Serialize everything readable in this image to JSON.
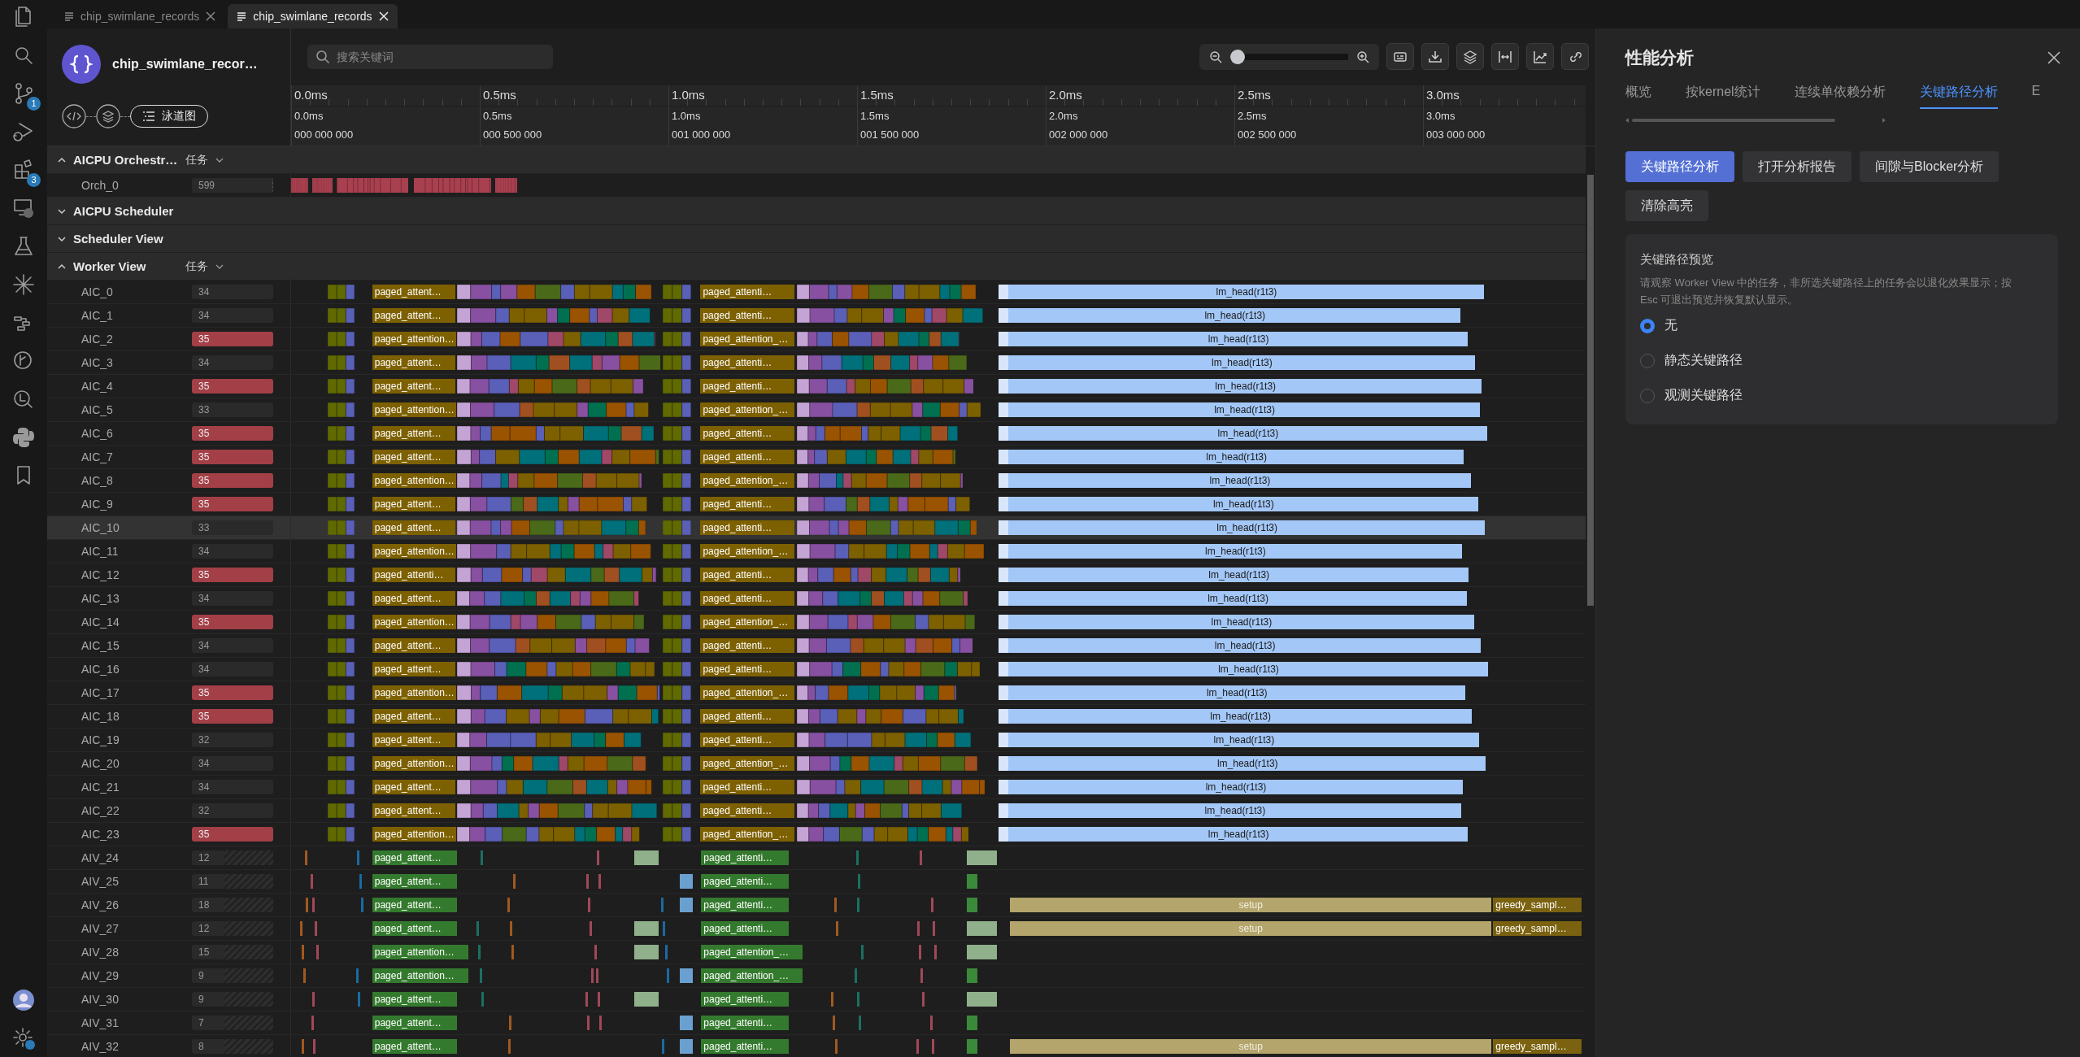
{
  "tabs": [
    {
      "label": "chip_swimlane_records",
      "selected": false
    },
    {
      "label": "chip_swimlane_records",
      "selected": true
    }
  ],
  "activity_bar": {
    "source_control_badge": "1",
    "extensions_badge": "3"
  },
  "file": {
    "title": "chip_swimlane_recor…",
    "view_button": "泳道图"
  },
  "search": {
    "placeholder": "搜索关键词"
  },
  "zoom": {
    "level": 0
  },
  "ruler": [
    {
      "major": "0.0ms",
      "minor": "0.0ms",
      "ns": "000 000 000"
    },
    {
      "major": "0.5ms",
      "minor": "0.5ms",
      "ns": "000 500 000"
    },
    {
      "major": "1.0ms",
      "minor": "1.0ms",
      "ns": "001 000 000"
    },
    {
      "major": "1.5ms",
      "minor": "1.5ms",
      "ns": "001 500 000"
    },
    {
      "major": "2.0ms",
      "minor": "2.0ms",
      "ns": "002 000 000"
    },
    {
      "major": "2.5ms",
      "minor": "2.5ms",
      "ns": "002 500 000"
    },
    {
      "major": "3.0ms",
      "minor": "3.0ms",
      "ns": "003 000 000"
    }
  ],
  "groups": [
    {
      "title": "AICPU Orchestr…",
      "expanded": true,
      "filter": "任务",
      "rows": [
        {
          "name": "Orch_0",
          "count": "599",
          "kind": "orch",
          "hot": false,
          "highlighted": false,
          "tasks": []
        }
      ]
    },
    {
      "title": "AICPU Scheduler",
      "expanded": false
    },
    {
      "title": "Scheduler View",
      "expanded": false
    },
    {
      "title": "Worker View",
      "expanded": true,
      "filter": "任务",
      "rows": [
        {
          "name": "AIC_0",
          "count": "34",
          "kind": "aic",
          "hot": false,
          "highlighted": false,
          "tasks": [
            {
              "label": "paged_attent…",
              "kind": "attn1"
            },
            {
              "label": "paged_attenti…",
              "kind": "attn2"
            },
            {
              "label": "lm_head(r1t3)",
              "kind": "lm_head"
            }
          ]
        },
        {
          "name": "AIC_1",
          "count": "34",
          "kind": "aic",
          "hot": false,
          "highlighted": false,
          "tasks": [
            {
              "label": "paged_attent…",
              "kind": "attn1"
            },
            {
              "label": "paged_attenti…",
              "kind": "attn2"
            },
            {
              "label": "lm_head(r1t3)",
              "kind": "lm_head"
            }
          ]
        },
        {
          "name": "AIC_2",
          "count": "35",
          "kind": "aic",
          "hot": true,
          "highlighted": false,
          "tasks": [
            {
              "label": "paged_attention…",
              "kind": "attn1"
            },
            {
              "label": "paged_attention_…",
              "kind": "attn2"
            },
            {
              "label": "lm_head(r1t3)",
              "kind": "lm_head"
            }
          ]
        },
        {
          "name": "AIC_3",
          "count": "34",
          "kind": "aic",
          "hot": false,
          "highlighted": false,
          "tasks": [
            {
              "label": "paged_attent…",
              "kind": "attn1"
            },
            {
              "label": "paged_attenti…",
              "kind": "attn2"
            },
            {
              "label": "lm_head(r1t3)",
              "kind": "lm_head"
            }
          ]
        },
        {
          "name": "AIC_4",
          "count": "35",
          "kind": "aic",
          "hot": true,
          "highlighted": false,
          "tasks": [
            {
              "label": "paged_attent…",
              "kind": "attn1"
            },
            {
              "label": "paged_attenti…",
              "kind": "attn2"
            },
            {
              "label": "lm_head(r1t3)",
              "kind": "lm_head"
            }
          ]
        },
        {
          "name": "AIC_5",
          "count": "33",
          "kind": "aic",
          "hot": false,
          "highlighted": false,
          "tasks": [
            {
              "label": "paged_attention…",
              "kind": "attn1"
            },
            {
              "label": "paged_attention_…",
              "kind": "attn2"
            },
            {
              "label": "lm_head(r1t3)",
              "kind": "lm_head"
            }
          ]
        },
        {
          "name": "AIC_6",
          "count": "35",
          "kind": "aic",
          "hot": true,
          "highlighted": false,
          "tasks": [
            {
              "label": "paged_attent…",
              "kind": "attn1"
            },
            {
              "label": "paged_attenti…",
              "kind": "attn2"
            },
            {
              "label": "lm_head(r1t3)",
              "kind": "lm_head"
            }
          ]
        },
        {
          "name": "AIC_7",
          "count": "35",
          "kind": "aic",
          "hot": true,
          "highlighted": false,
          "tasks": [
            {
              "label": "paged_attent…",
              "kind": "attn1"
            },
            {
              "label": "paged_attenti…",
              "kind": "attn2"
            },
            {
              "label": "lm_head(r1t3)",
              "kind": "lm_head"
            }
          ]
        },
        {
          "name": "AIC_8",
          "count": "35",
          "kind": "aic",
          "hot": true,
          "highlighted": false,
          "tasks": [
            {
              "label": "paged_attention…",
              "kind": "attn1"
            },
            {
              "label": "paged_attention_…",
              "kind": "attn2"
            },
            {
              "label": "lm_head(r1t3)",
              "kind": "lm_head"
            }
          ]
        },
        {
          "name": "AIC_9",
          "count": "35",
          "kind": "aic",
          "hot": true,
          "highlighted": false,
          "tasks": [
            {
              "label": "paged_attent…",
              "kind": "attn1"
            },
            {
              "label": "paged_attenti…",
              "kind": "attn2"
            },
            {
              "label": "lm_head(r1t3)",
              "kind": "lm_head"
            }
          ]
        },
        {
          "name": "AIC_10",
          "count": "33",
          "kind": "aic",
          "hot": false,
          "highlighted": true,
          "tasks": [
            {
              "label": "paged_attent…",
              "kind": "attn1"
            },
            {
              "label": "paged_attenti…",
              "kind": "attn2"
            },
            {
              "label": "lm_head(r1t3)",
              "kind": "lm_head"
            }
          ]
        },
        {
          "name": "AIC_11",
          "count": "34",
          "kind": "aic",
          "hot": false,
          "highlighted": false,
          "tasks": [
            {
              "label": "paged_attention…",
              "kind": "attn1"
            },
            {
              "label": "paged_attention_…",
              "kind": "attn2"
            },
            {
              "label": "lm_head(r1t3)",
              "kind": "lm_head"
            }
          ]
        },
        {
          "name": "AIC_12",
          "count": "35",
          "kind": "aic",
          "hot": true,
          "highlighted": false,
          "tasks": [
            {
              "label": "paged_attenti…",
              "kind": "attn1"
            },
            {
              "label": "paged_attenti…",
              "kind": "attn2"
            },
            {
              "label": "lm_head(r1t3)",
              "kind": "lm_head"
            }
          ]
        },
        {
          "name": "AIC_13",
          "count": "34",
          "kind": "aic",
          "hot": false,
          "highlighted": false,
          "tasks": [
            {
              "label": "paged_attent…",
              "kind": "attn1"
            },
            {
              "label": "paged_attenti…",
              "kind": "attn2"
            },
            {
              "label": "lm_head(r1t3)",
              "kind": "lm_head"
            }
          ]
        },
        {
          "name": "AIC_14",
          "count": "35",
          "kind": "aic",
          "hot": true,
          "highlighted": false,
          "tasks": [
            {
              "label": "paged_attention…",
              "kind": "attn1"
            },
            {
              "label": "paged_attention_…",
              "kind": "attn2"
            },
            {
              "label": "lm_head(r1t3)",
              "kind": "lm_head"
            }
          ]
        },
        {
          "name": "AIC_15",
          "count": "34",
          "kind": "aic",
          "hot": false,
          "highlighted": false,
          "tasks": [
            {
              "label": "paged_attent…",
              "kind": "attn1"
            },
            {
              "label": "paged_attenti…",
              "kind": "attn2"
            },
            {
              "label": "lm_head(r1t3)",
              "kind": "lm_head"
            }
          ]
        },
        {
          "name": "AIC_16",
          "count": "34",
          "kind": "aic",
          "hot": false,
          "highlighted": false,
          "tasks": [
            {
              "label": "paged_attent…",
              "kind": "attn1"
            },
            {
              "label": "paged_attenti…",
              "kind": "attn2"
            },
            {
              "label": "lm_head(r1t3)",
              "kind": "lm_head"
            }
          ]
        },
        {
          "name": "AIC_17",
          "count": "35",
          "kind": "aic",
          "hot": true,
          "highlighted": false,
          "tasks": [
            {
              "label": "paged_attention…",
              "kind": "attn1"
            },
            {
              "label": "paged_attention_…",
              "kind": "attn2"
            },
            {
              "label": "lm_head(r1t3)",
              "kind": "lm_head"
            }
          ]
        },
        {
          "name": "AIC_18",
          "count": "35",
          "kind": "aic",
          "hot": true,
          "highlighted": false,
          "tasks": [
            {
              "label": "paged_attent…",
              "kind": "attn1"
            },
            {
              "label": "paged_attenti…",
              "kind": "attn2"
            },
            {
              "label": "lm_head(r1t3)",
              "kind": "lm_head"
            }
          ]
        },
        {
          "name": "AIC_19",
          "count": "32",
          "kind": "aic",
          "hot": false,
          "highlighted": false,
          "tasks": [
            {
              "label": "paged_attent…",
              "kind": "attn1"
            },
            {
              "label": "paged_attenti…",
              "kind": "attn2"
            },
            {
              "label": "lm_head(r1t3)",
              "kind": "lm_head"
            }
          ]
        },
        {
          "name": "AIC_20",
          "count": "34",
          "kind": "aic",
          "hot": false,
          "highlighted": false,
          "tasks": [
            {
              "label": "paged_attention…",
              "kind": "attn1"
            },
            {
              "label": "paged_attention_…",
              "kind": "attn2"
            },
            {
              "label": "lm_head(r1t3)",
              "kind": "lm_head"
            }
          ]
        },
        {
          "name": "AIC_21",
          "count": "34",
          "kind": "aic",
          "hot": false,
          "highlighted": false,
          "tasks": [
            {
              "label": "paged_attent…",
              "kind": "attn1"
            },
            {
              "label": "paged_attenti…",
              "kind": "attn2"
            },
            {
              "label": "lm_head(r1t3)",
              "kind": "lm_head"
            }
          ]
        },
        {
          "name": "AIC_22",
          "count": "32",
          "kind": "aic",
          "hot": false,
          "highlighted": false,
          "tasks": [
            {
              "label": "paged_attent…",
              "kind": "attn1"
            },
            {
              "label": "paged_attenti…",
              "kind": "attn2"
            },
            {
              "label": "lm_head(r1t3)",
              "kind": "lm_head"
            }
          ]
        },
        {
          "name": "AIC_23",
          "count": "35",
          "kind": "aic",
          "hot": true,
          "highlighted": false,
          "tasks": [
            {
              "label": "paged_attention…",
              "kind": "attn1"
            },
            {
              "label": "paged_attention_…",
              "kind": "attn2"
            },
            {
              "label": "lm_head(r1t3)",
              "kind": "lm_head"
            }
          ]
        },
        {
          "name": "AIV_24",
          "count": "12",
          "kind": "aiv",
          "hot": false,
          "highlighted": false,
          "tasks": [
            {
              "label": "paged_attent…",
              "kind": "attn1"
            },
            {
              "label": "paged_attenti…",
              "kind": "attn2"
            }
          ]
        },
        {
          "name": "AIV_25",
          "count": "11",
          "kind": "aiv",
          "hot": false,
          "highlighted": false,
          "tasks": [
            {
              "label": "paged_attent…",
              "kind": "attn1"
            },
            {
              "label": "paged_attenti…",
              "kind": "attn2"
            }
          ]
        },
        {
          "name": "AIV_26",
          "count": "18",
          "kind": "aiv",
          "hot": false,
          "highlighted": false,
          "tasks": [
            {
              "label": "paged_attent…",
              "kind": "attn1"
            },
            {
              "label": "paged_attenti…",
              "kind": "attn2"
            },
            {
              "label": "setup",
              "kind": "setup"
            },
            {
              "label": "greedy_sampl…",
              "kind": "greedy"
            }
          ]
        },
        {
          "name": "AIV_27",
          "count": "12",
          "kind": "aiv",
          "hot": false,
          "highlighted": false,
          "tasks": [
            {
              "label": "paged_attent…",
              "kind": "attn1"
            },
            {
              "label": "paged_attenti…",
              "kind": "attn2"
            },
            {
              "label": "setup",
              "kind": "setup"
            },
            {
              "label": "greedy_sampl…",
              "kind": "greedy"
            }
          ]
        },
        {
          "name": "AIV_28",
          "count": "15",
          "kind": "aiv",
          "hot": false,
          "highlighted": false,
          "tasks": [
            {
              "label": "paged_attention…",
              "kind": "attn1"
            },
            {
              "label": "paged_attention_…",
              "kind": "attn2"
            }
          ]
        },
        {
          "name": "AIV_29",
          "count": "9",
          "kind": "aiv",
          "hot": false,
          "highlighted": false,
          "tasks": [
            {
              "label": "paged_attention…",
              "kind": "attn1"
            },
            {
              "label": "paged_attention_…",
              "kind": "attn2"
            }
          ]
        },
        {
          "name": "AIV_30",
          "count": "9",
          "kind": "aiv",
          "hot": false,
          "highlighted": false,
          "tasks": [
            {
              "label": "paged_attent…",
              "kind": "attn1"
            },
            {
              "label": "paged_attenti…",
              "kind": "attn2"
            }
          ]
        },
        {
          "name": "AIV_31",
          "count": "7",
          "kind": "aiv",
          "hot": false,
          "highlighted": false,
          "tasks": [
            {
              "label": "paged_attent…",
              "kind": "attn1"
            },
            {
              "label": "paged_attenti…",
              "kind": "attn2"
            }
          ]
        },
        {
          "name": "AIV_32",
          "count": "8",
          "kind": "aiv",
          "hot": false,
          "highlighted": false,
          "tasks": [
            {
              "label": "paged_attent…",
              "kind": "attn1"
            },
            {
              "label": "paged_attenti…",
              "kind": "attn2"
            },
            {
              "label": "setup",
              "kind": "setup"
            },
            {
              "label": "greedy_sampl…",
              "kind": "greedy"
            }
          ]
        }
      ]
    }
  ],
  "panel": {
    "title": "性能分析",
    "tabs": [
      {
        "label": "概览",
        "selected": false
      },
      {
        "label": "按kernel统计",
        "selected": false
      },
      {
        "label": "连续单依赖分析",
        "selected": false
      },
      {
        "label": "关键路径分析",
        "selected": true
      },
      {
        "label": "E",
        "selected": false
      }
    ],
    "buttons": [
      {
        "label": "关键路径分析",
        "kind": "primary"
      },
      {
        "label": "打开分析报告",
        "kind": "secondary"
      },
      {
        "label": "间隙与Blocker分析",
        "kind": "secondary"
      },
      {
        "label": "清除高亮",
        "kind": "secondary"
      }
    ],
    "preview": {
      "title": "关键路径预览",
      "description": "请观察 Worker View 中的任务，非所选关键路径上的任务会以退化效果显示；按 Esc 可退出预览并恢复默认显示。",
      "options": [
        {
          "label": "无",
          "selected": true
        },
        {
          "label": "静态关键路径",
          "selected": false
        },
        {
          "label": "观测关键路径",
          "selected": false
        }
      ]
    }
  }
}
